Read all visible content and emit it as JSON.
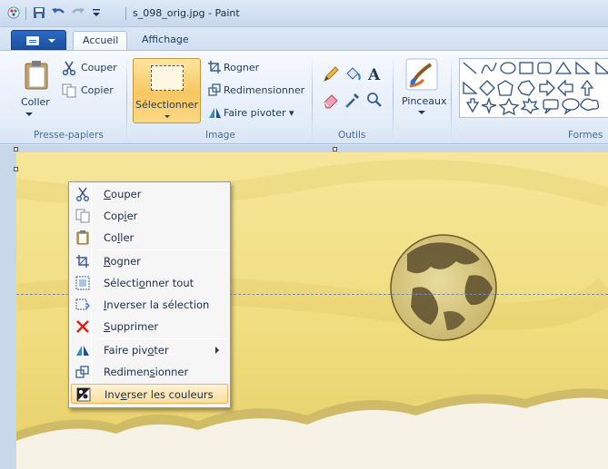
{
  "window": {
    "title": "s_098_orig.jpg - Paint"
  },
  "tabs": [
    {
      "label": "Accueil",
      "active": true
    },
    {
      "label": "Affichage",
      "active": false
    }
  ],
  "clipboard": {
    "paste_label": "Coller",
    "cut_label": "Couper",
    "copy_label": "Copier",
    "group_label": "Presse-papiers"
  },
  "image_group": {
    "select_label": "Sélectionner",
    "crop_label": "Rogner",
    "resize_label": "Redimensionner",
    "rotate_label": "Faire pivoter ▾",
    "group_label": "Image"
  },
  "tools": {
    "group_label": "Outils",
    "text_tool": "A"
  },
  "brushes": {
    "label": "Pinceaux"
  },
  "shapes": {
    "group_label": "Formes"
  },
  "context_menu": {
    "items": [
      {
        "pre": "",
        "u": "C",
        "post": "ouper",
        "icon": "scissors-icon"
      },
      {
        "pre": "Cop",
        "u": "i",
        "post": "er",
        "icon": "copy-icon"
      },
      {
        "pre": "Co",
        "u": "l",
        "post": "ler",
        "icon": "paste-icon"
      },
      {
        "pre": "",
        "u": "R",
        "post": "ogner",
        "icon": "crop-icon"
      },
      {
        "pre": "Sélecti",
        "u": "o",
        "post": "nner tout",
        "icon": "select-all-icon"
      },
      {
        "pre": "",
        "u": "I",
        "post": "nverser la sélection",
        "icon": "invert-selection-icon"
      },
      {
        "pre": "",
        "u": "S",
        "post": "upprimer",
        "icon": "delete-icon"
      },
      {
        "pre": "Faire piv",
        "u": "o",
        "post": "ter",
        "icon": "rotate-icon",
        "submenu": true
      },
      {
        "pre": "Redimen",
        "u": "s",
        "post": "ionner",
        "icon": "resize-icon"
      },
      {
        "pre": "Inv",
        "u": "e",
        "post": "rser les couleurs",
        "icon": "invert-colors-icon",
        "highlighted": true
      }
    ]
  },
  "colors": {
    "canvas_yellow": "#f1df80",
    "highlight": "#fbdf9c",
    "ribbon_blue": "#1c4f9f"
  }
}
